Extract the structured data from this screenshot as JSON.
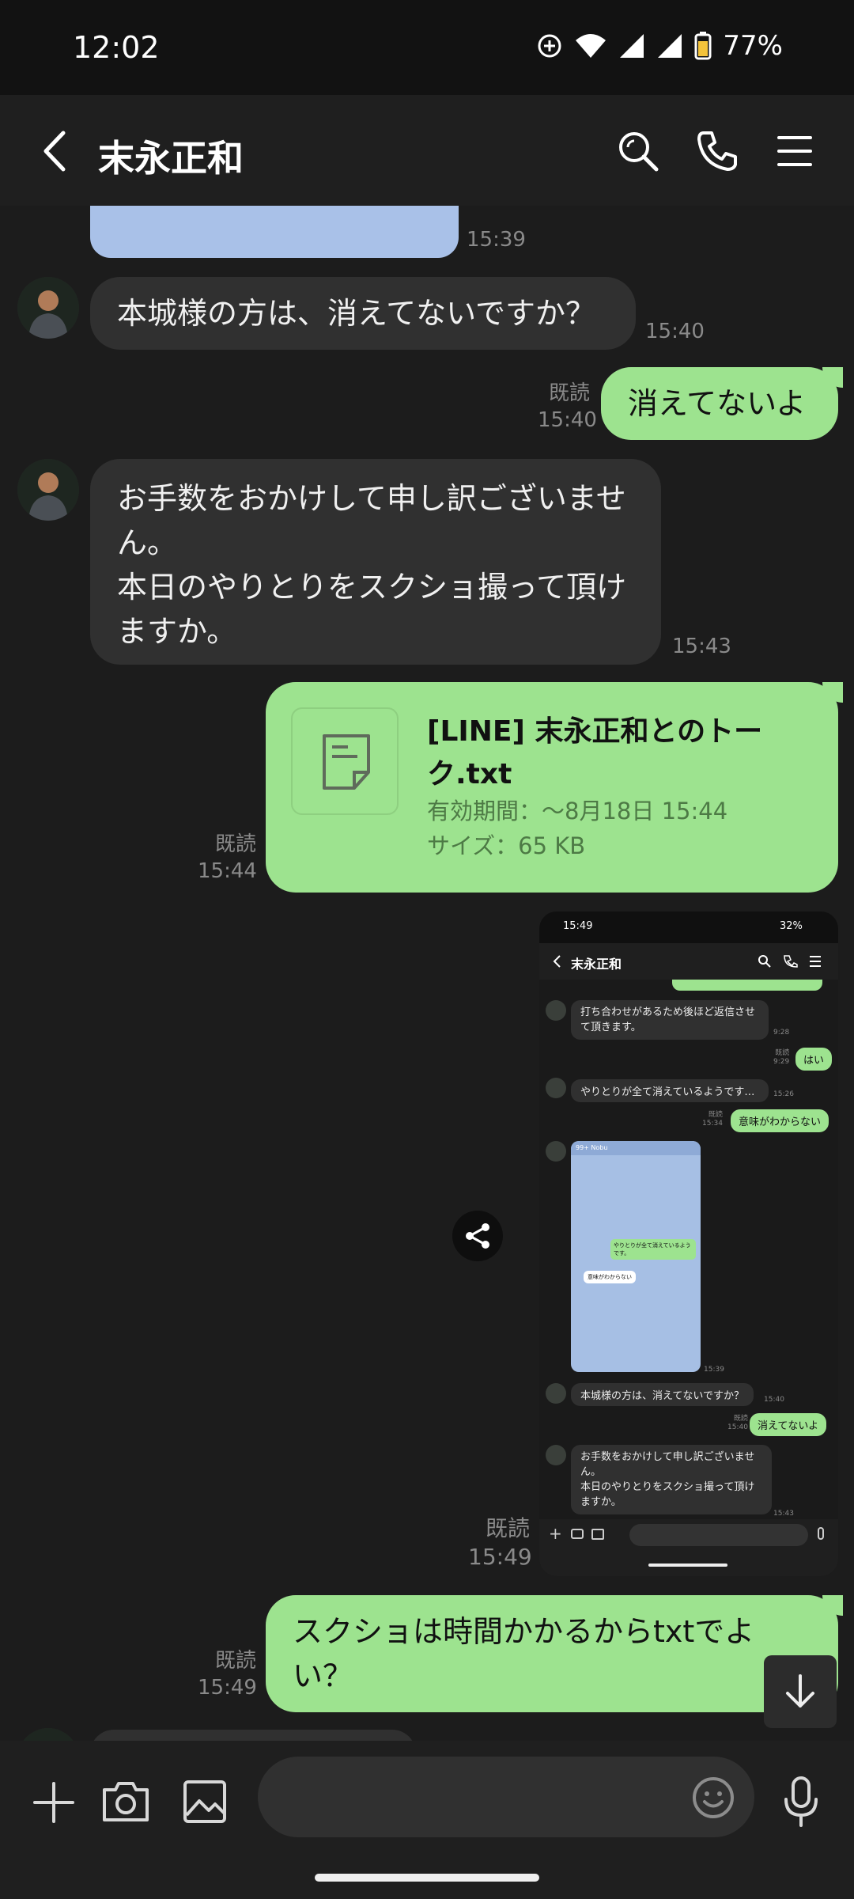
{
  "status_bar": {
    "time": "12:02",
    "battery": "77%"
  },
  "header": {
    "title": "末永正和"
  },
  "messages": [
    {
      "time": "15:39"
    },
    {
      "text": "本城様の方は、消えてないですか？",
      "time": "15:40"
    },
    {
      "read": "既読",
      "time": "15:40",
      "text": "消えてないよ"
    },
    {
      "text": "お手数をおかけして申し訳ございません。\n本日のやりとりをスクショ撮って頂けますか。",
      "time": "15:43"
    },
    {
      "read": "既読",
      "time": "15:44",
      "file_name": "[LINE] 末永正和とのトーク.txt",
      "expiry": "有効期間：～8月18日 15:44",
      "size": "サイズ：65 KB"
    },
    {
      "read": "既読",
      "time": "15:49"
    },
    {
      "read": "既読",
      "time": "15:49",
      "text": "スクショは時間かかるからtxtでよい？"
    }
  ],
  "thumbnail": {
    "time": "15:49",
    "battery": "32%",
    "title": "末永正和",
    "msgs": [
      {
        "text": "打ち合わせがあるため後ほど返信させて頂きます。",
        "time": "9:28"
      },
      {
        "read": "既読",
        "time": "9:29",
        "text": "はい"
      },
      {
        "text": "やりとりが全て消えているようです…",
        "time": "15:26"
      },
      {
        "read": "既読",
        "time": "15:34",
        "text": "意味がわからない"
      },
      {
        "inner_header": "99+  Nobu",
        "inner_out": "やりとりが全て消えているようです。",
        "inner_in": "意味がわからない",
        "time": "15:39"
      },
      {
        "text": "本城様の方は、消えてないですか？",
        "time": "15:40"
      },
      {
        "read": "既読",
        "time": "15:40",
        "text": "消えてないよ"
      },
      {
        "text": "お手数をおかけして申し訳ございません。\n本日のやりとりをスクショ撮って頂けますか。",
        "time": "15:43"
      }
    ]
  }
}
